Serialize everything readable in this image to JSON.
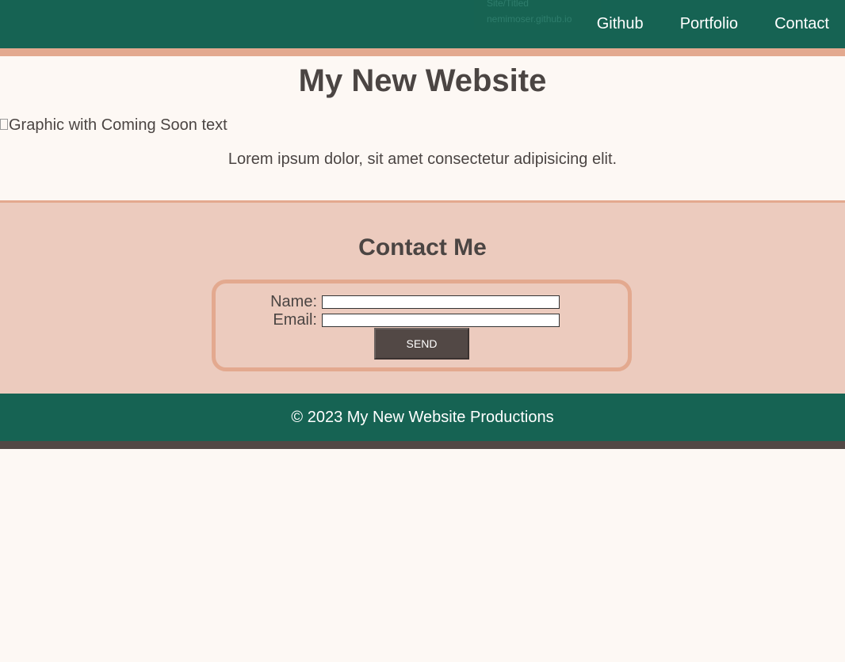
{
  "tooltip": {
    "line1": "Site/Titled",
    "line2": "nemimoser.github.io"
  },
  "nav": {
    "items": [
      {
        "label": "Github"
      },
      {
        "label": "Portfolio"
      },
      {
        "label": "Contact"
      }
    ]
  },
  "main": {
    "title": "My New Website",
    "image_alt": "Graphic with Coming Soon text",
    "intro": "Lorem ipsum dolor, sit amet consectetur adipisicing elit."
  },
  "contact": {
    "title": "Contact Me",
    "name_label": "Name:",
    "name_value": "",
    "email_label": "Email:",
    "email_value": "",
    "send_label": "SEND"
  },
  "footer": {
    "text": "© 2023 My New Website Productions"
  },
  "colors": {
    "header_bg": "#166353",
    "accent": "#e3a98f",
    "contact_bg": "#eccbbe",
    "text": "#4b4543",
    "page_bg": "#fdf8f4",
    "button_bg": "#524845"
  }
}
